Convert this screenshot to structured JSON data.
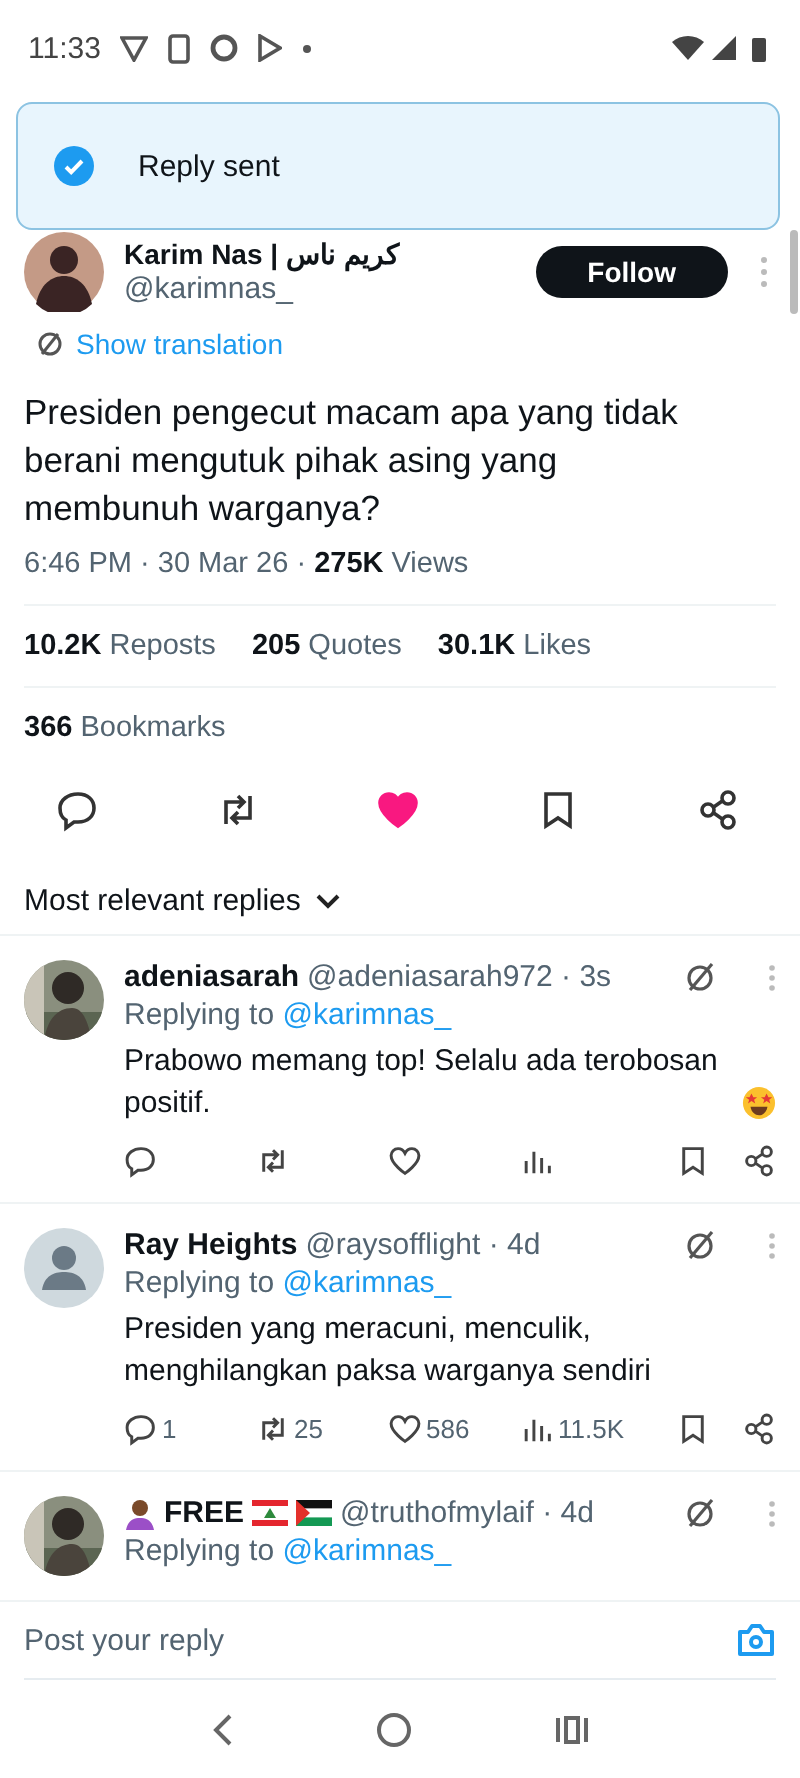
{
  "status_bar": {
    "time": "11:33"
  },
  "toast": {
    "text": "Reply sent"
  },
  "tweet": {
    "author": "Karim Nas | كريم ناس",
    "handle": "@karimnas_",
    "follow": "Follow",
    "translate": "Show translation",
    "text": "Presiden pengecut macam apa yang tidak berani mengutuk pihak asing yang membunuh warganya?",
    "time": "6:46 PM · 30 Mar 26 · ",
    "views": "275K",
    "views_label": "Views",
    "stats": [
      "**10.2K** Reposts",
      "**205** Quotes",
      "**30.1K** Likes"
    ],
    "bookmarks": "**366** Bookmarks",
    "liked": true,
    "bookmarked": false
  },
  "sort": {
    "label": "Most relevant replies"
  },
  "replies": [
    {
      "name": "adeniasarah",
      "handle": "@adeniasarah972 · 3s",
      "replying": "Replying to ",
      "mention": "@karimnas_",
      "text": "Prabowo memang top! Selalu ada terobosan positif.",
      "emoji": true,
      "decorated": false,
      "actions": true
    },
    {
      "name": "Ray Heights",
      "handle": "@raysofflight · 4d",
      "replying": "Replying to ",
      "mention": "@karimnas_",
      "text": "Presiden yang meracuni, menculik, menghilangkan paksa warganya sendiri",
      "emoji": false,
      "decorated": false,
      "avatar": {
        "kind": "default"
      },
      "actions": true,
      "counts": {
        "reply": "1",
        "repost": "25",
        "like": "586",
        "views": "11.5K"
      }
    },
    {
      "name": "FREE",
      "handle": "@truthofmylaif · 4d",
      "replying": "Replying to ",
      "mention": "@karimnas_",
      "decorated": true,
      "actions": false
    }
  ],
  "composer": {
    "placeholder": "Post your reply"
  }
}
